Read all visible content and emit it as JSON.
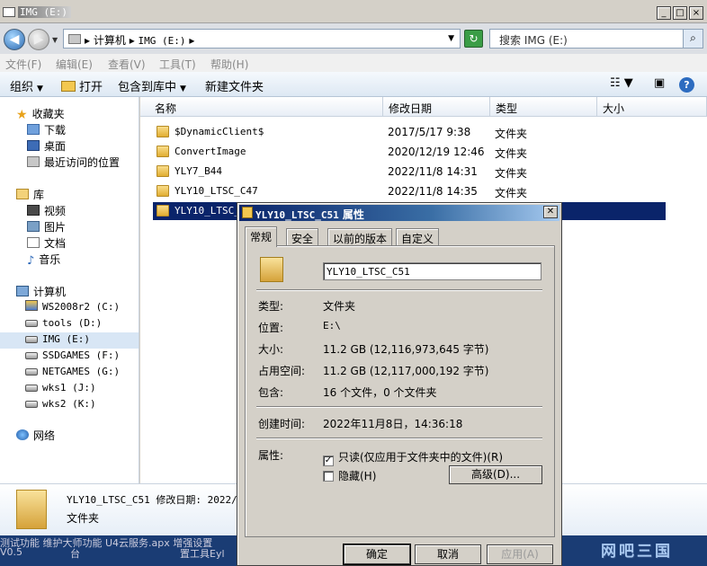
{
  "window": {
    "title": "IMG (E:)"
  },
  "address": {
    "crumb1": "计算机",
    "crumb2": "IMG (E:)",
    "search_placeholder": "搜索 IMG (E:)"
  },
  "menu": {
    "items": [
      "文件(F)",
      "编辑(E)",
      "查看(V)",
      "工具(T)",
      "帮助(H)"
    ]
  },
  "toolbar": {
    "organize": "组织",
    "open": "打开",
    "include": "包含到库中",
    "new_folder": "新建文件夹"
  },
  "nav": {
    "favorites": "收藏夹",
    "downloads": "下载",
    "desktop": "桌面",
    "recent": "最近访问的位置",
    "libraries": "库",
    "videos": "视频",
    "pictures": "图片",
    "documents": "文档",
    "music": "音乐",
    "computer": "计算机",
    "drives": [
      "WS2008r2 (C:)",
      "tools (D:)",
      "IMG (E:)",
      "SSDGAMES (F:)",
      "NETGAMES (G:)",
      "wks1 (J:)",
      "wks2 (K:)"
    ],
    "network": "网络"
  },
  "columns": {
    "name": "名称",
    "date": "修改日期",
    "type": "类型",
    "size": "大小"
  },
  "files": [
    {
      "name": "$DynamicClient$",
      "date": "2017/5/17 9:38",
      "type": "文件夹"
    },
    {
      "name": "ConvertImage",
      "date": "2020/12/19 12:46",
      "type": "文件夹"
    },
    {
      "name": "YLY7_B44",
      "date": "2022/11/8 14:31",
      "type": "文件夹"
    },
    {
      "name": "YLY10_LTSC_C47",
      "date": "2022/11/8 14:35",
      "type": "文件夹"
    },
    {
      "name": "YLY10_LTSC_C51",
      "date": "",
      "type": ""
    }
  ],
  "details": {
    "name_line": "YLY10_LTSC_C51  修改日期: 2022/",
    "type": "文件夹"
  },
  "taskbar": {
    "line1": "测试功能  维护大师功能  U4云服务.apx  增强设置",
    "line2a": "V0.5",
    "line2b": "台",
    "line2c": "置工具Eyl"
  },
  "watermark": "网吧三国",
  "dialog": {
    "title_name": "YLY10_LTSC_C51",
    "title_suffix": "属性",
    "close": "✕",
    "tabs": [
      "常规",
      "安全",
      "以前的版本",
      "自定义"
    ],
    "name_value": "YLY10_LTSC_C51",
    "labels": {
      "type": "类型:",
      "location": "位置:",
      "size": "大小:",
      "disk": "占用空间:",
      "contains": "包含:",
      "created": "创建时间:",
      "attrs": "属性:"
    },
    "values": {
      "type": "文件夹",
      "location": "E:\\",
      "size": "11.2 GB (12,116,973,645 字节)",
      "disk": "11.2 GB (12,117,000,192 字节)",
      "contains": "16 个文件，0 个文件夹",
      "created": "2022年11月8日，14:36:18"
    },
    "readonly": "只读(仅应用于文件夹中的文件)(R)",
    "hidden": "隐藏(H)",
    "advanced": "高级(D)...",
    "ok": "确定",
    "cancel": "取消",
    "apply": "应用(A)"
  }
}
